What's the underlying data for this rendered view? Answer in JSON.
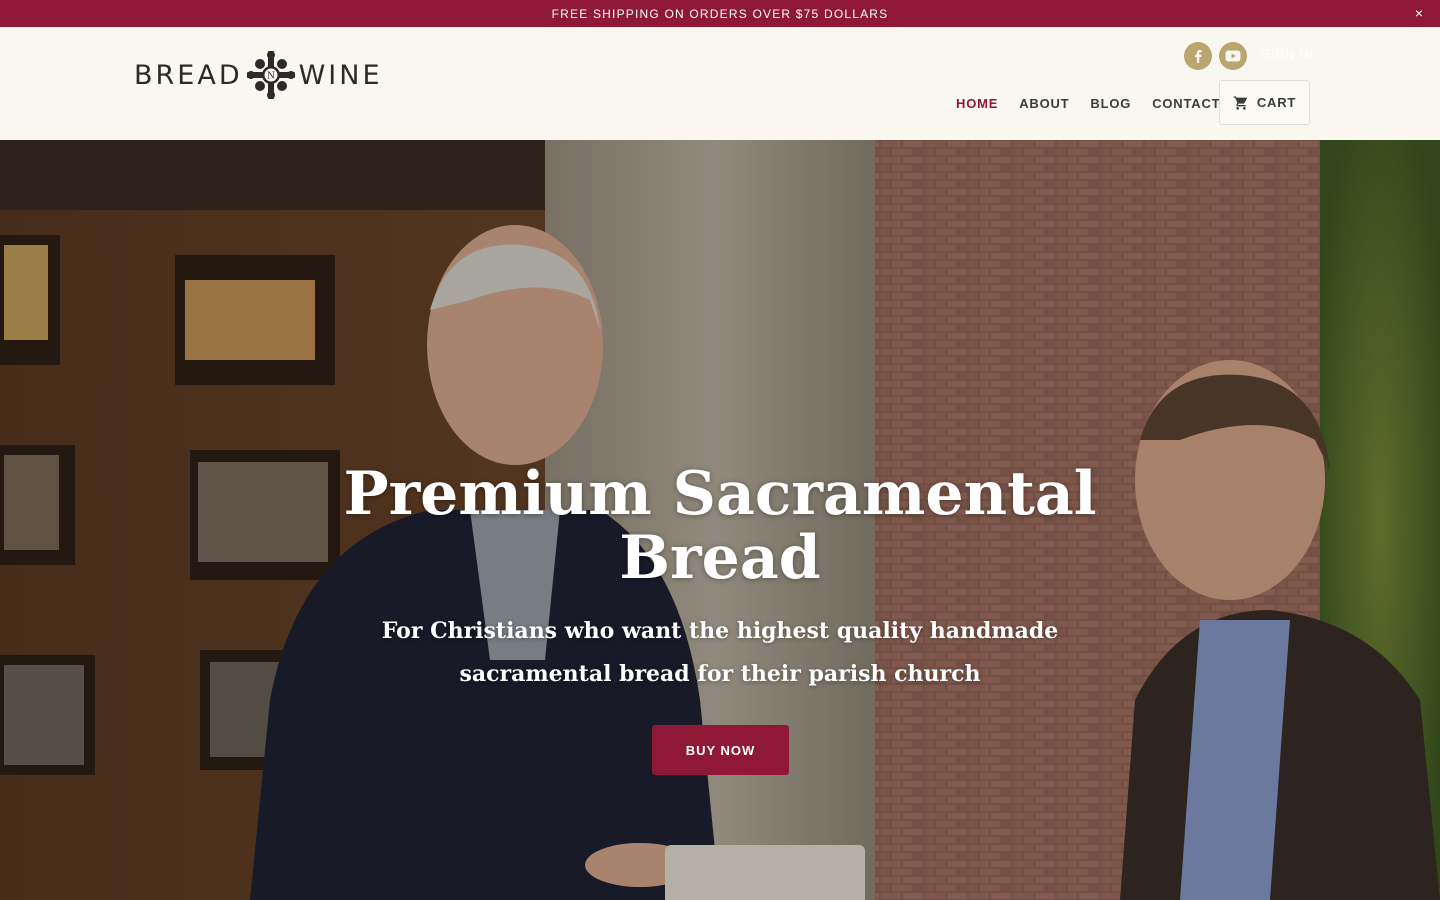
{
  "announcement": {
    "text": "FREE SHIPPING ON ORDERS OVER $75 DOLLARS",
    "close_label": "×"
  },
  "header": {
    "logo": {
      "left_word": "BREAD",
      "right_word": "WINE"
    },
    "social": [
      {
        "name": "facebook-icon",
        "glyph": "f"
      },
      {
        "name": "youtube-icon",
        "glyph": "▶"
      }
    ],
    "signin_label": "SIGN IN",
    "nav": [
      {
        "label": "HOME",
        "active": true
      },
      {
        "label": "ABOUT",
        "active": false
      },
      {
        "label": "BLOG",
        "active": false
      },
      {
        "label": "CONTACT",
        "active": false
      }
    ],
    "cart_label": "CART"
  },
  "hero": {
    "title_line1": "Premium Sacramental",
    "title_line2": "Bread",
    "subtitle_line1": "For Christians who want the highest quality handmade",
    "subtitle_line2": "sacramental bread for their parish church",
    "cta_label": "BUY NOW"
  },
  "colors": {
    "brand": "#8e1836",
    "header_bg": "#faf7f1",
    "social": "#b8a670",
    "text": "#3c3c3c"
  }
}
